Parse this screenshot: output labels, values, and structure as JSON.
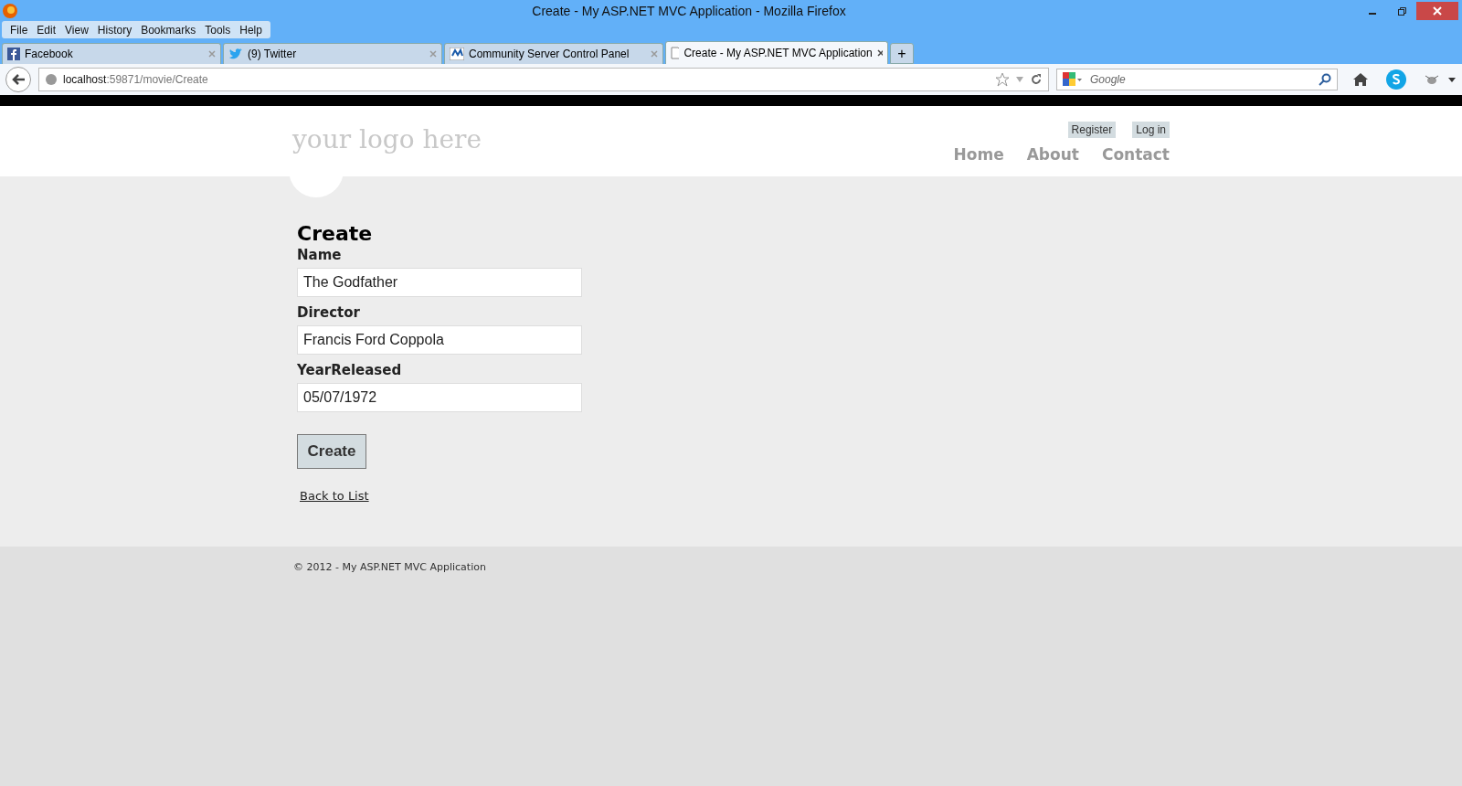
{
  "window": {
    "title": "Create - My ASP.NET MVC Application - Mozilla Firefox"
  },
  "menu": [
    "File",
    "Edit",
    "View",
    "History",
    "Bookmarks",
    "Tools",
    "Help"
  ],
  "tabs": [
    {
      "label": "Facebook",
      "selected": false
    },
    {
      "label": "(9) Twitter",
      "selected": false
    },
    {
      "label": "Community Server Control Panel",
      "selected": false
    },
    {
      "label": "Create - My ASP.NET MVC Application",
      "selected": true
    }
  ],
  "new_tab": "+",
  "address": {
    "host": "localhost",
    "path": ":59871/movie/Create"
  },
  "search": {
    "placeholder": "Google"
  },
  "site": {
    "logo": "your logo here",
    "account_links": [
      "Register",
      "Log in"
    ],
    "nav": [
      "Home",
      "About",
      "Contact"
    ]
  },
  "form": {
    "heading": "Create",
    "fields": [
      {
        "label": "Name",
        "value": "The Godfather"
      },
      {
        "label": "Director",
        "value": "Francis Ford Coppola"
      },
      {
        "label": "YearReleased",
        "value": "05/07/1972"
      }
    ],
    "submit": "Create",
    "back_link": "Back to List"
  },
  "footer": "© 2012 - My ASP.NET MVC Application"
}
